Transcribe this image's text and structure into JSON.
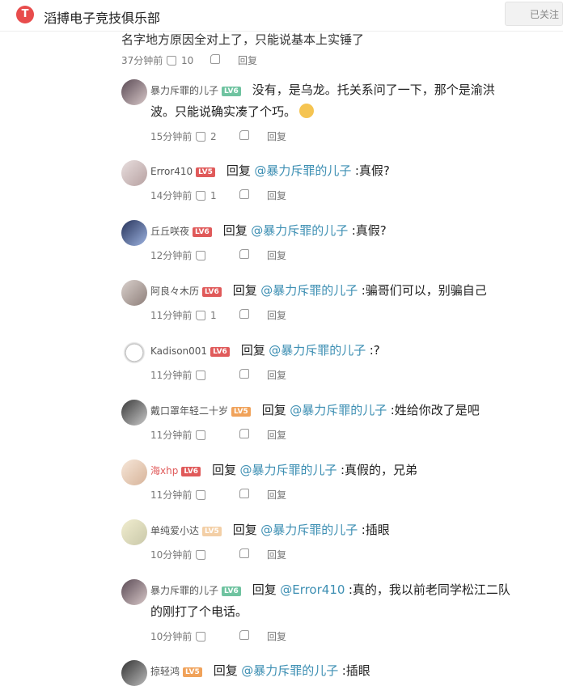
{
  "header": {
    "club_name": "滔搏电子竞技俱乐部",
    "followed": "已关注"
  },
  "top_comment": {
    "partial_text": "名字地方原因全对上了，只能说基本上实锤了",
    "time": "37分钟前",
    "likes": "10",
    "reply": "回复"
  },
  "comments": [
    {
      "user": "暴力斥罪的儿子",
      "level": "LV6",
      "prefix": "",
      "mention": "",
      "body": "没有，是乌龙。托关系问了一下，那个是渝洪",
      "body2": "波。只能说确实凑了个巧。",
      "time": "15分钟前",
      "likes": "2",
      "reply": "回复"
    },
    {
      "user": "Error410",
      "level": "LV5",
      "prefix": "回复",
      "mention": "@暴力斥罪的儿子",
      "body": ":真假?",
      "time": "14分钟前",
      "likes": "1",
      "reply": "回复"
    },
    {
      "user": "丘丘咲夜",
      "level": "LV6",
      "prefix": "回复",
      "mention": "@暴力斥罪的儿子",
      "body": ":真假?",
      "time": "12分钟前",
      "likes": "",
      "reply": "回复"
    },
    {
      "user": "阿良々木历",
      "level": "LV6",
      "prefix": "回复",
      "mention": "@暴力斥罪的儿子",
      "body": ":骗哥们可以，别骗自己",
      "time": "11分钟前",
      "likes": "1",
      "reply": "回复"
    },
    {
      "user": "Kadison001",
      "level": "LV6",
      "prefix": "回复",
      "mention": "@暴力斥罪的儿子",
      "body": ":?",
      "time": "11分钟前",
      "likes": "",
      "reply": "回复"
    },
    {
      "user": "戴口罩年轻二十岁",
      "level": "LV5",
      "prefix": "回复",
      "mention": "@暴力斥罪的儿子",
      "body": ":姓给你改了是吧",
      "time": "11分钟前",
      "likes": "",
      "reply": "回复"
    },
    {
      "user": "海xhp",
      "level": "LV6",
      "prefix": "回复",
      "mention": "@暴力斥罪的儿子",
      "body": ":真假的，兄弟",
      "time": "11分钟前",
      "likes": "",
      "reply": "回复"
    },
    {
      "user": "单纯爱小达",
      "level": "LV5",
      "prefix": "回复",
      "mention": "@暴力斥罪的儿子",
      "body": ":插眼",
      "time": "10分钟前",
      "likes": "",
      "reply": "回复"
    },
    {
      "user": "暴力斥罪的儿子",
      "level": "LV6",
      "prefix": "回复",
      "mention": "@Error410",
      "body": ":真的，我以前老同学松江二队",
      "body2": "的刚打了个电话。",
      "time": "10分钟前",
      "likes": "",
      "reply": "回复"
    },
    {
      "user": "掠轻鸿",
      "level": "LV5",
      "prefix": "回复",
      "mention": "@暴力斥罪的儿子",
      "body": ":插眼",
      "time": "",
      "likes": "",
      "reply": ""
    }
  ]
}
